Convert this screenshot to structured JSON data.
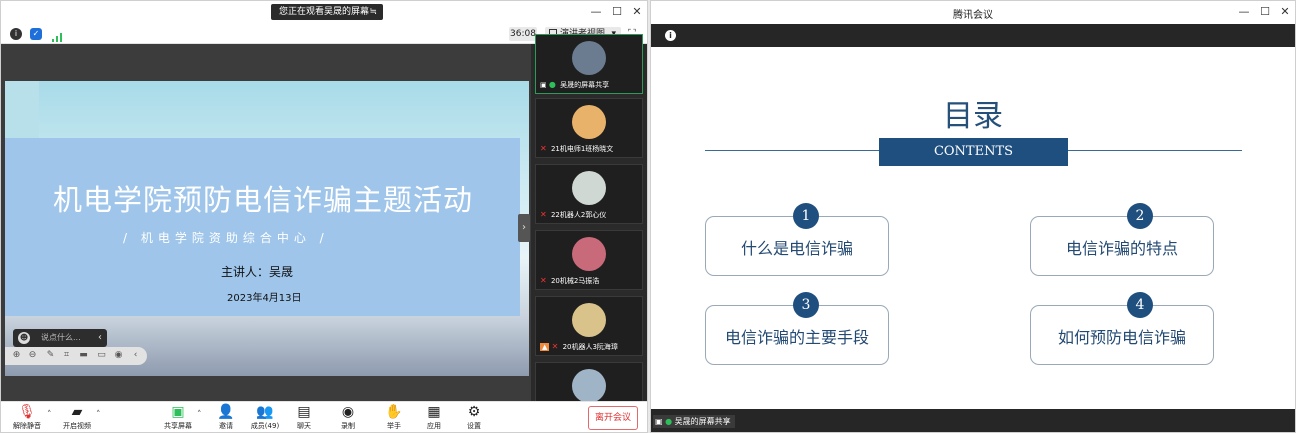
{
  "left_window": {
    "share_banner": "您正在观看吴晟的屏幕",
    "share_banner_icon": "≒",
    "window_controls": [
      "—",
      "☐",
      "✕"
    ],
    "timer": "36:08",
    "view_mode": "演讲者视图",
    "view_mode_caret": "▾",
    "slide": {
      "title": "机电学院预防电信诈骗主题活动",
      "subtitle": "/ 机电学院资助综合中心 /",
      "speaker": "主讲人：吴晟",
      "date": "2023年4月13日"
    },
    "chat_placeholder": "说点什么...",
    "gallery": [
      {
        "name": "吴晟的屏幕共享",
        "avatar_color": "#6b7c91",
        "active": true
      },
      {
        "name": "21机电师1班杨晓文",
        "avatar_color": "#e8b26a",
        "active": false
      },
      {
        "name": "22机器人2郭心仪",
        "avatar_color": "#cfd8d2",
        "active": false
      },
      {
        "name": "20机械2马振浩",
        "avatar_color": "#c86a7a",
        "active": false
      },
      {
        "name": "20机器人3阮海璋",
        "avatar_color": "#d9c38a",
        "active": false
      },
      {
        "name": "",
        "avatar_color": "#9fb4c6",
        "active": false
      }
    ],
    "toolbar": {
      "unmute": "解除静音",
      "start_video": "开启视频",
      "share_screen": "共享屏幕",
      "invite": "邀请",
      "members": "成员(49)",
      "chat": "聊天",
      "record": "录制",
      "raise_hand": "举手",
      "apps": "应用",
      "settings": "设置",
      "leave": "离开会议"
    }
  },
  "right_window": {
    "title": "腾讯会议",
    "window_controls": [
      "—",
      "☐",
      "✕"
    ],
    "slide": {
      "heading": "目录",
      "contents": "CONTENTS",
      "items": [
        {
          "num": "1",
          "text": "什么是电信诈骗"
        },
        {
          "num": "2",
          "text": "电信诈骗的特点"
        },
        {
          "num": "3",
          "text": "电信诈骗的主要手段"
        },
        {
          "num": "4",
          "text": "如何预防电信诈骗"
        }
      ]
    },
    "share_label": "吴晟的屏幕共享"
  },
  "colors": {
    "accent": "#1f4f7f",
    "leave_red": "#e03030",
    "toolbar_dark": "#262626"
  }
}
